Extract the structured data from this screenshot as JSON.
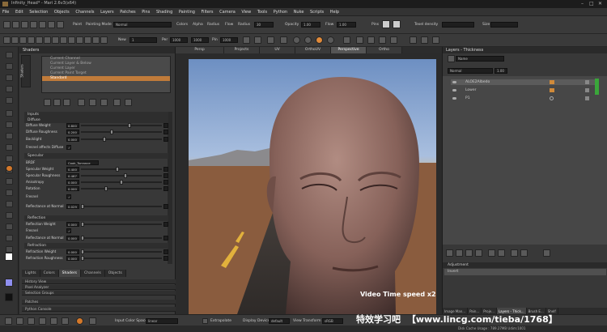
{
  "window": {
    "title": "Infinity_Head* - Mari 2.6v3(x64)"
  },
  "menu": [
    "File",
    "Edit",
    "Selection",
    "Objects",
    "Channels",
    "Layers",
    "Patches",
    "Pins",
    "Shading",
    "Painting",
    "Filters",
    "Camera",
    "View",
    "Tools",
    "Python",
    "Nuke",
    "Scripts",
    "Help"
  ],
  "toolbar1": {
    "paint_label": "Paint",
    "painting_mode_label": "Painting Mode",
    "painting_mode_value": "Normal",
    "colors_label": "Colors",
    "alpha_label": "Alpha",
    "radius_label": "Radius",
    "flow_label": "Flow",
    "radius2_label": "Radius",
    "radius_value": "30",
    "opacity_label": "Opacity",
    "opacity_value": "1.00",
    "flow2_label": "Flow",
    "flow_value": "1.00",
    "pins_label": "Pins",
    "texel_label": "Texel density",
    "size_label": "Size"
  },
  "toolbar2": {
    "new_label": "New",
    "new_value": "1",
    "per_label": "Per",
    "per_value": "1000",
    "per_value2": "1000",
    "pin_label": "Pin",
    "pin_value": "1000"
  },
  "shaders": {
    "title": "Shaders",
    "side_tab": "Shaders",
    "list": [
      "Current Channel",
      "Current Layer & Below",
      "Current Layer",
      "Current Paint Target",
      "Standard"
    ],
    "selected": "Standard",
    "sections": {
      "inputs": "Inputs",
      "diffuse": "Diffuse",
      "specular": "Specular",
      "reflection": "Reflection",
      "refraction": "Refraction"
    },
    "rows": [
      {
        "label": "Diffuse Weight",
        "value": "0.800",
        "level": 0.6
      },
      {
        "label": "Diffuse Roughness",
        "value": "0.200",
        "level": 0.38
      },
      {
        "label": "Backlight",
        "value": "0.000",
        "level": 0.28
      },
      {
        "label": "Fresnel affects Diffuse",
        "value": "",
        "level": -1
      },
      {
        "label": "BRDF",
        "value": "Cook_Torrance",
        "level": -1
      },
      {
        "label": "Specular Weight",
        "value": "0.400",
        "level": 0.45
      },
      {
        "label": "Specular Roughness",
        "value": "0.467",
        "level": 0.55
      },
      {
        "label": "Anisotropy",
        "value": "0.000",
        "level": 0.5
      },
      {
        "label": "Rotation",
        "value": "0.000",
        "level": 0.3
      },
      {
        "label": "Fresnel",
        "value": "",
        "level": -1
      },
      {
        "label": "Reflectance at Normal",
        "value": "0.029",
        "level": 0.0
      },
      {
        "label": "Reflection Weight",
        "value": "0.000",
        "level": 0.0
      },
      {
        "label": "Fresnel",
        "value": "",
        "level": -1
      },
      {
        "label": "Reflectance at Normal",
        "value": "0.000",
        "level": 0.0
      },
      {
        "label": "Refraction Weight",
        "value": "0.000",
        "level": 0.0
      },
      {
        "label": "Refraction Roughness",
        "value": "0.000",
        "level": 0.0
      }
    ]
  },
  "bottom_tabs": [
    "Lights",
    "Colors",
    "Shaders",
    "Channels",
    "Objects"
  ],
  "bottom_tabs_active": "Shaders",
  "docked": [
    "History View",
    "Pixel Analyzer",
    "Selection Groups",
    "Patches",
    "Python Console"
  ],
  "view_tabs": [
    "Persp",
    "Projects",
    "UV",
    "OrthoUV",
    "Perspective",
    "Ortho"
  ],
  "view_tabs_active": "Perspective",
  "layers": {
    "title": "Layers - Thickness",
    "mode": "Name",
    "blend": "Normal",
    "opacity": "1.00",
    "items": [
      "ALOE2Albedo",
      "Lower",
      "P1"
    ],
    "selected": "ALOE2Albedo",
    "adjustment_title": "Adjustment",
    "adjustment_value": "Invert"
  },
  "right_tabs": [
    "Image Man...",
    "Pain...",
    "Proje...",
    "Layers - Thick...",
    "Brush E...",
    "Shelf"
  ],
  "statusbar": {
    "color_space_label": "Input Color Space",
    "color_space_value": "linear",
    "extrapolate_label": "Extrapolate",
    "display_device_label": "Display Device",
    "display_device_value": "default",
    "view_transform_label": "View Transform",
    "view_transform_value": "sRGB",
    "disk_cache": "Disk Cache Usage : 789.27MB  Udim:1001"
  },
  "overlay": {
    "video_speed": "Video Time speed x2.5",
    "watermark_cn": "特效学习吧",
    "watermark_url": "【www.lincg.com/tieba/1768】"
  },
  "colors": {
    "accent": "#c07b3a",
    "selection": "#c07b3a",
    "viewport_sky": "#6d8fc2"
  }
}
